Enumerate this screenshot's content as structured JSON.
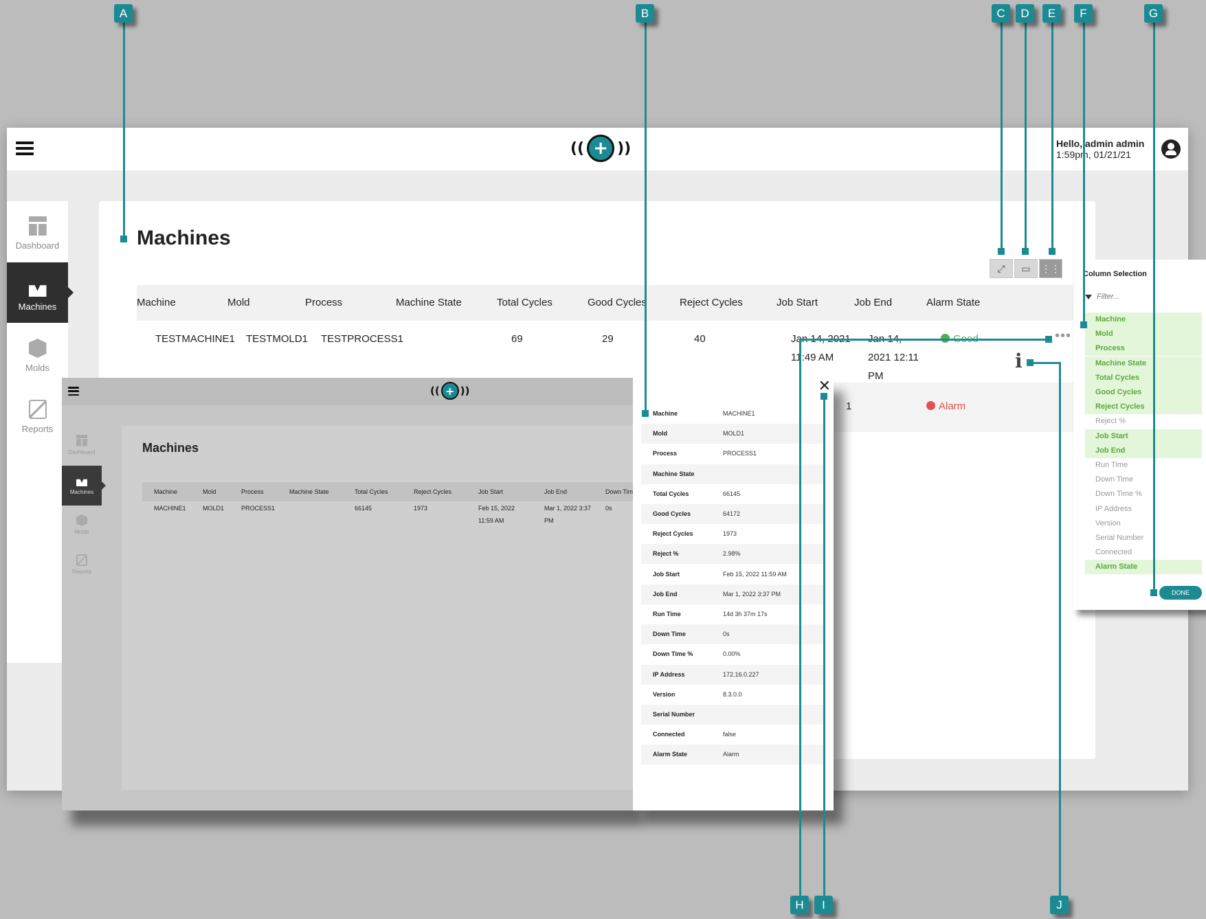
{
  "app": {
    "greeting": "Hello, admin admin",
    "datetime": "1:59pm, 01/21/21",
    "logo_symbol": "+",
    "sidebar": [
      {
        "label": "Dashboard",
        "icon": "dashboard-icon"
      },
      {
        "label": "Machines",
        "icon": "machines-icon",
        "active": true
      },
      {
        "label": "Molds",
        "icon": "molds-icon"
      },
      {
        "label": "Reports",
        "icon": "reports-icon"
      }
    ],
    "page_title": "Machines",
    "toolbar": {
      "expand_icon": "expand-icon",
      "archive_icon": "archive-icon",
      "columns_icon": "column-selection-icon"
    },
    "table": {
      "headers": [
        "Machine",
        "Mold",
        "Process",
        "Machine State",
        "Total Cycles",
        "Good Cycles",
        "Reject Cycles",
        "Job Start",
        "Job End",
        "Alarm State"
      ],
      "row1": {
        "machine": "TESTMACHINE1",
        "mold": "TESTMOLD1",
        "process": "TESTPROCESS1",
        "total_cycles": "69",
        "good_cycles": "29",
        "reject_cycles": "40",
        "job_start_1": "Jan 14, 2021",
        "job_start_2": "11:49 AM",
        "job_end_1": "Jan 14,",
        "job_end_2": "2021 12:11",
        "job_end_3": "PM",
        "alarm_state": "Good"
      },
      "row2": {
        "partial": "1",
        "alarm_state": "Alarm"
      },
      "more_icon": "•••",
      "info_icon": "i"
    },
    "colors": {
      "good": "#4caf50",
      "alarm": "#e05252",
      "accent": "#1b8a93"
    }
  },
  "column_selection": {
    "title": "Column Selection",
    "filter_placeholder": "Filter...",
    "options": [
      {
        "label": "Machine",
        "on": true
      },
      {
        "label": "Mold",
        "on": true
      },
      {
        "label": "Process",
        "on": true
      },
      {
        "label": "Machine State",
        "on": true
      },
      {
        "label": "Total Cycles",
        "on": true
      },
      {
        "label": "Good Cycles",
        "on": true
      },
      {
        "label": "Reject Cycles",
        "on": true
      },
      {
        "label": "Reject %",
        "on": false
      },
      {
        "label": "Job Start",
        "on": true
      },
      {
        "label": "Job End",
        "on": true
      },
      {
        "label": "Run Time",
        "on": false
      },
      {
        "label": "Down Time",
        "on": false
      },
      {
        "label": "Down Time %",
        "on": false
      },
      {
        "label": "IP Address",
        "on": false
      },
      {
        "label": "Version",
        "on": false
      },
      {
        "label": "Serial Number",
        "on": false
      },
      {
        "label": "Connected",
        "on": false
      },
      {
        "label": "Alarm State",
        "on": true
      }
    ],
    "done_label": "DONE"
  },
  "inset_window": {
    "page_title": "Machines",
    "sidebar": [
      {
        "label": "Dashboard"
      },
      {
        "label": "Machines",
        "active": true
      },
      {
        "label": "Molds"
      },
      {
        "label": "Reports"
      }
    ],
    "headers": [
      "Machine",
      "Mold",
      "Process",
      "Machine State",
      "Total Cycles",
      "Reject Cycles",
      "Job Start",
      "Job End",
      "Down Tim"
    ],
    "row1": {
      "machine": "MACHINE1",
      "mold": "MOLD1",
      "process": "PROCESS1",
      "total_cycles": "66145",
      "reject_cycles": "1973",
      "job_start_1": "Feb 15, 2022",
      "job_start_2": "11:59 AM",
      "job_end_1": "Mar 1, 2022 3:37",
      "job_end_2": "PM",
      "down_time": "0s"
    }
  },
  "details": {
    "close_icon": "✕",
    "rows": [
      {
        "k": "Machine",
        "v": "MACHINE1"
      },
      {
        "k": "Mold",
        "v": "MOLD1"
      },
      {
        "k": "Process",
        "v": "PROCESS1"
      },
      {
        "k": "Machine State",
        "v": ""
      },
      {
        "k": "Total Cycles",
        "v": "66145"
      },
      {
        "k": "Good Cycles",
        "v": "64172"
      },
      {
        "k": "Reject Cycles",
        "v": "1973"
      },
      {
        "k": "Reject %",
        "v": "2.98%"
      },
      {
        "k": "Job Start",
        "v": "Feb 15, 2022 11:59 AM"
      },
      {
        "k": "Job End",
        "v": "Mar 1, 2022 3:37 PM"
      },
      {
        "k": "Run Time",
        "v": "14d 3h 37m 17s"
      },
      {
        "k": "Down Time",
        "v": "0s"
      },
      {
        "k": "Down Time %",
        "v": "0.00%"
      },
      {
        "k": "IP Address",
        "v": "172.16.0.227"
      },
      {
        "k": "Version",
        "v": "8.3.0.0"
      },
      {
        "k": "Serial Number",
        "v": ""
      },
      {
        "k": "Connected",
        "v": "false"
      },
      {
        "k": "Alarm State",
        "v": "Alarm"
      }
    ]
  },
  "callouts": {
    "A": "A",
    "B": "B",
    "C": "C",
    "D": "D",
    "E": "E",
    "F": "F",
    "G": "G",
    "H": "H",
    "I": "I",
    "J": "J"
  }
}
